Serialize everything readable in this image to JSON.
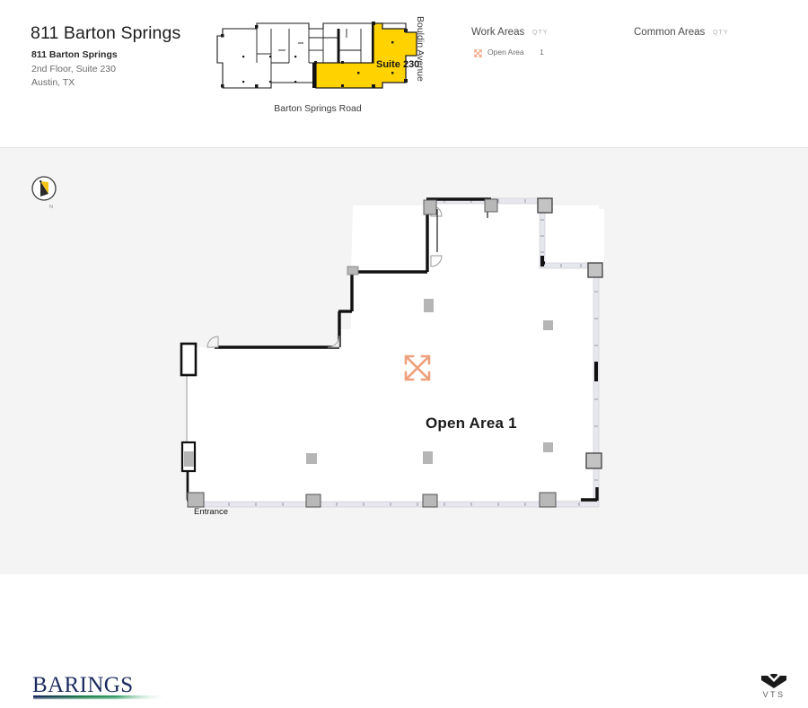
{
  "header": {
    "building_title": "811 Barton Springs",
    "address": {
      "name": "811 Barton Springs",
      "line2": "2nd Floor, Suite 230",
      "line3": "Austin, TX"
    }
  },
  "keyplan": {
    "suite_label": "Suite 230",
    "street_bottom": "Barton Springs Road",
    "street_right": "Bouldin Avenue",
    "highlight_color": "#FFD200",
    "outline_color": "#1a1a1a"
  },
  "legends": {
    "work_areas": {
      "title": "Work Areas",
      "qty_header": "QTY",
      "rows": [
        {
          "icon": "open-area-icon",
          "label": "Open Area",
          "qty": "1"
        }
      ]
    },
    "common_areas": {
      "title": "Common Areas",
      "qty_header": "QTY",
      "rows": []
    }
  },
  "canvas": {
    "compass_icon": "north-arrow-icon",
    "compass_letter": "N",
    "entrance_label": "Entrance",
    "area_label": "Open Area 1",
    "open_area_icon": "expand-arrows-icon",
    "accent_color": "#EFA07C",
    "wall_color": "#111111",
    "glazing_color": "#d9d9e0",
    "column_color": "#b5b5b5",
    "background": "#f4f4f4"
  },
  "footer": {
    "barings_logo_text": "BARINGS",
    "vts_logo_text": "VTS"
  }
}
